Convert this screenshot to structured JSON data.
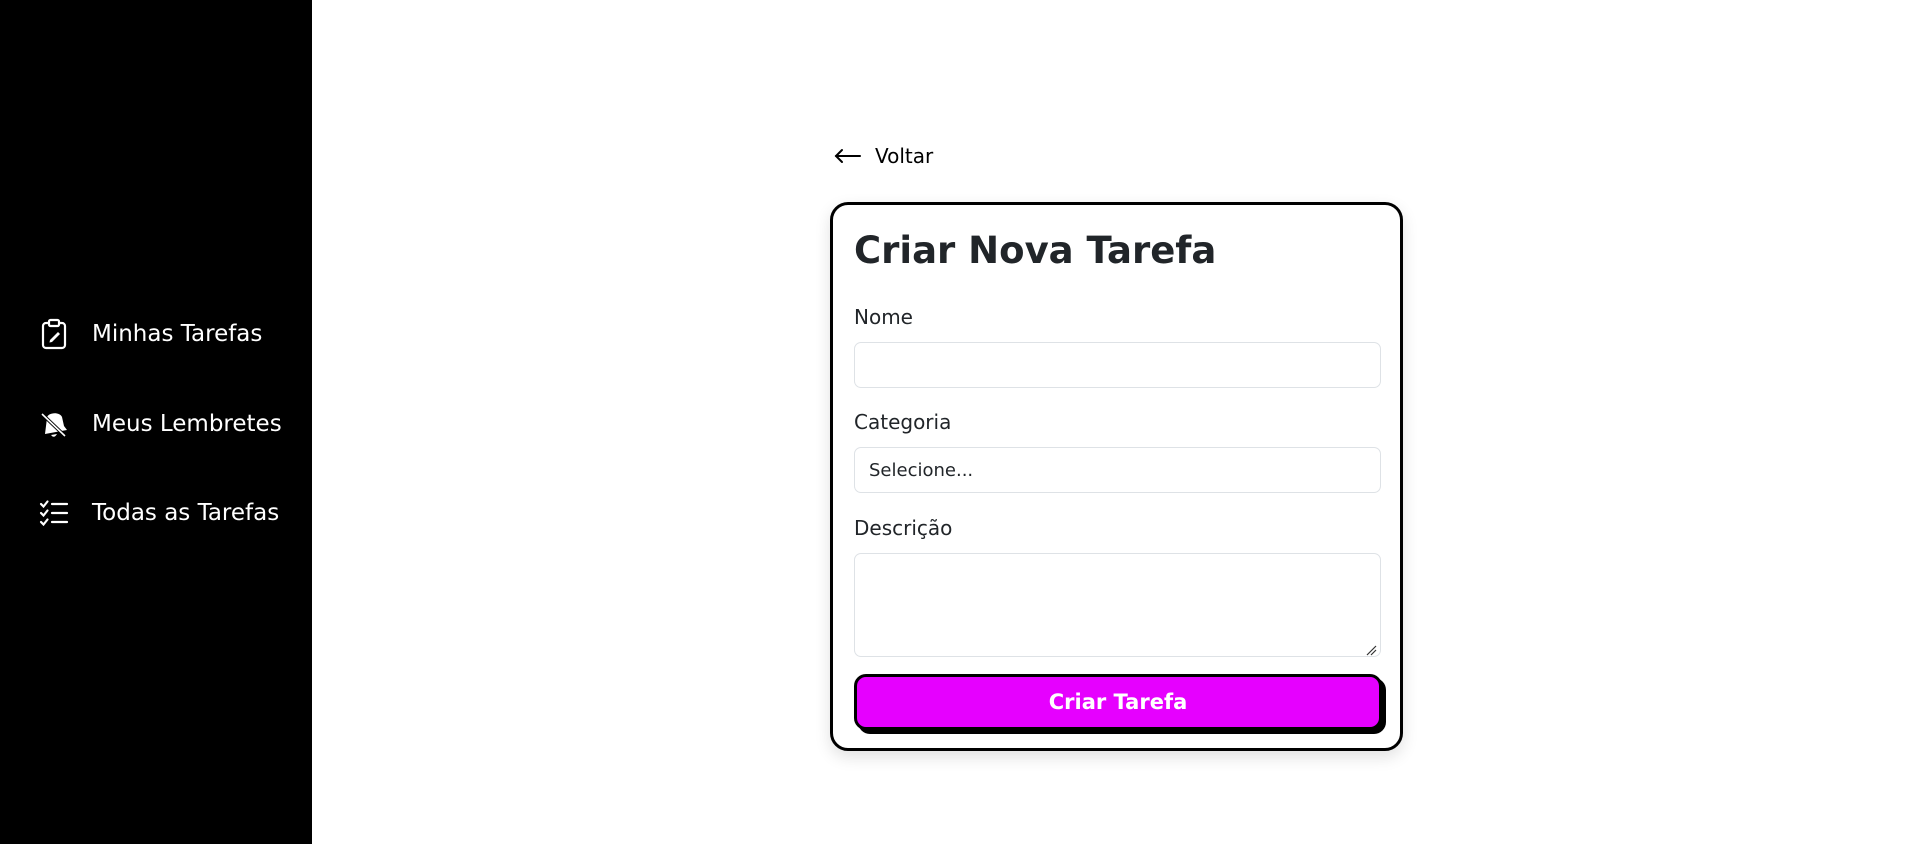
{
  "sidebar": {
    "items": [
      {
        "label": "Minhas Tarefas",
        "icon": "clipboard-check-icon"
      },
      {
        "label": "Meus Lembretes",
        "icon": "bell-slash-icon"
      },
      {
        "label": "Todas as Tarefas",
        "icon": "list-check-icon"
      }
    ]
  },
  "back": {
    "label": "Voltar",
    "icon": "arrow-left-icon"
  },
  "form": {
    "title": "Criar Nova Tarefa",
    "name": {
      "label": "Nome",
      "value": "",
      "placeholder": ""
    },
    "category": {
      "label": "Categoria",
      "selected": "Selecione..."
    },
    "description": {
      "label": "Descrição",
      "value": ""
    },
    "submit_label": "Criar Tarefa"
  },
  "colors": {
    "sidebar_bg": "#000000",
    "accent": "#e600ff",
    "border": "#000000"
  }
}
